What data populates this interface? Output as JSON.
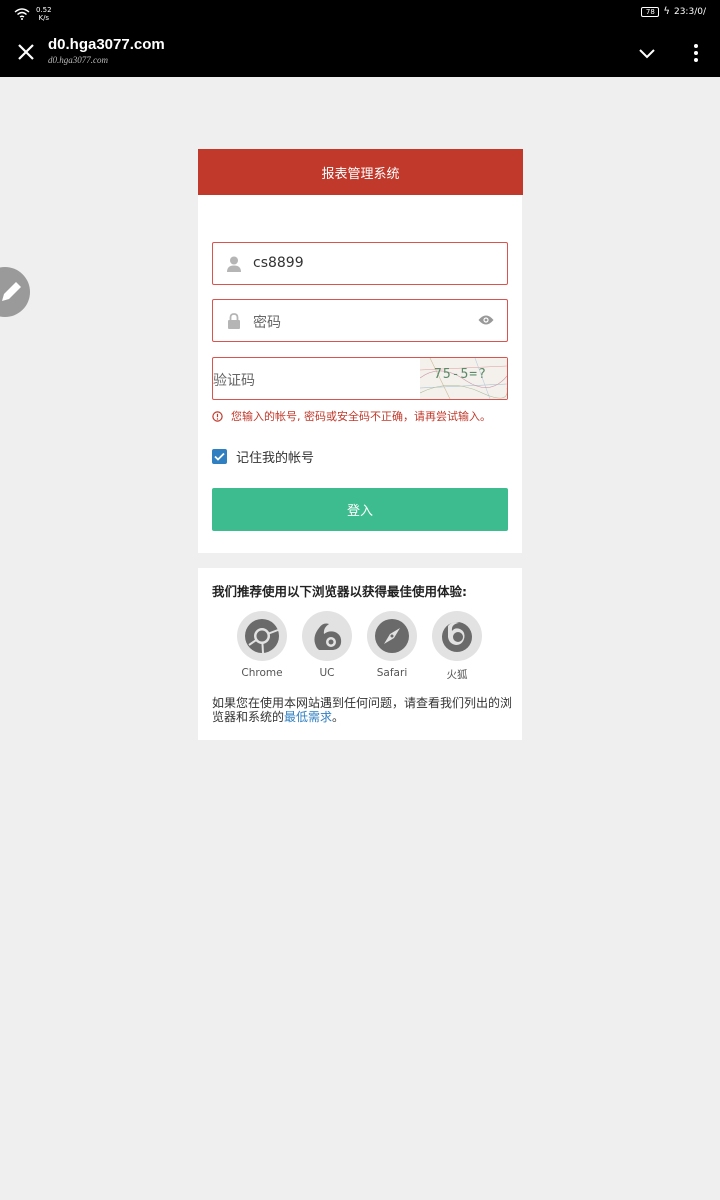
{
  "status_bar": {
    "net_speed_value": "0.52",
    "net_speed_unit": "K/s",
    "battery": "78",
    "time": "23:3/0/"
  },
  "browser": {
    "url_title": "d0.hga3077.com",
    "url_sub": "d0.hga3077.com"
  },
  "login": {
    "header_title": "报表管理系统",
    "username_value": "cs8899",
    "password_placeholder": "密码",
    "captcha_placeholder": "验证码",
    "captcha_image_text": "75-5=?",
    "error_message": "您输入的帐号, 密码或安全码不正确，请再尝试输入。",
    "remember_label": "记住我的帐号",
    "remember_checked": true,
    "login_button": "登入"
  },
  "recommend": {
    "title": "我们推荐使用以下浏览器以获得最佳使用体验:",
    "browsers": [
      {
        "name": "Chrome",
        "icon": "chrome-icon"
      },
      {
        "name": "UC",
        "icon": "uc-browser-icon"
      },
      {
        "name": "Safari",
        "icon": "safari-icon"
      },
      {
        "name": "火狐",
        "icon": "firefox-icon"
      }
    ],
    "help_text": "如果您在使用本网站遇到任何问题，请查看我们列出的浏览器和系统的",
    "help_link": "最低需求",
    "help_end": "。"
  },
  "colors": {
    "header_red": "#c0392b",
    "login_green": "#3dbd8f",
    "link_blue": "#2f7fc1",
    "checkbox_blue": "#2f7fc1"
  }
}
